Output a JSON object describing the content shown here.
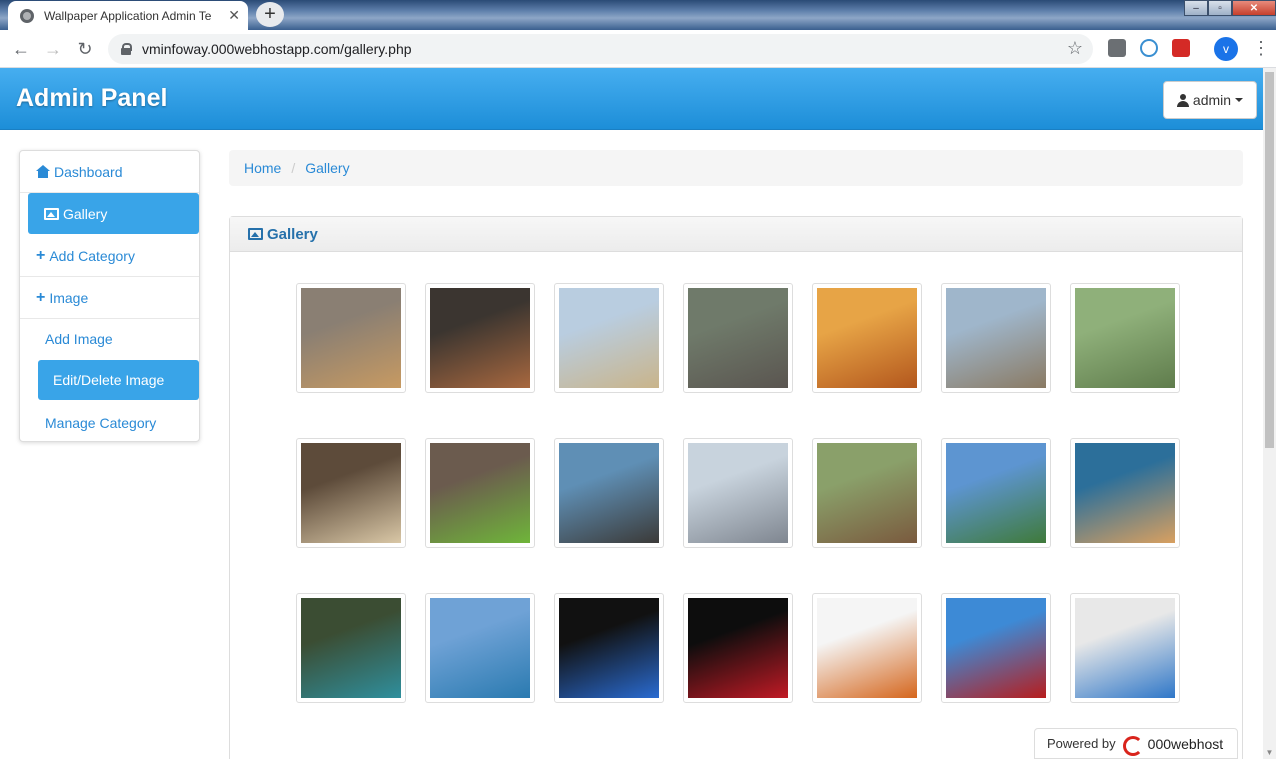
{
  "browser": {
    "tab_title": "Wallpaper Application Admin Te",
    "url": "vminfoway.000webhostapp.com/gallery.php",
    "profile_initial": "v"
  },
  "navbar": {
    "brand": "Admin Panel",
    "user_label": "admin"
  },
  "sidebar": {
    "items": [
      {
        "label": "Dashboard",
        "icon": "home-icon"
      },
      {
        "label": "Gallery",
        "icon": "picture-icon"
      },
      {
        "label": "Add Category",
        "icon": "plus-icon"
      },
      {
        "label": "Image",
        "icon": "plus-icon"
      }
    ],
    "sub_items": [
      {
        "label": "Add Image"
      },
      {
        "label": "Edit/Delete Image"
      },
      {
        "label": "Manage Category"
      }
    ]
  },
  "breadcrumb": {
    "home": "Home",
    "current": "Gallery"
  },
  "panel": {
    "title": "Gallery"
  },
  "gallery": {
    "images": [
      {
        "subject": "cats",
        "colors": [
          "#8a7f73",
          "#c79a62"
        ]
      },
      {
        "subject": "deer",
        "colors": [
          "#3b3530",
          "#a8683f"
        ]
      },
      {
        "subject": "elephant",
        "colors": [
          "#b9cde0",
          "#c9b48a"
        ]
      },
      {
        "subject": "rhinoceros",
        "colors": [
          "#6f7a6a",
          "#5a5550"
        ]
      },
      {
        "subject": "lion",
        "colors": [
          "#e7a446",
          "#b3571d"
        ]
      },
      {
        "subject": "giraffes",
        "colors": [
          "#9fb6cb",
          "#8a7a63"
        ]
      },
      {
        "subject": "bulbul bird",
        "colors": [
          "#8fb07a",
          "#5f7c4c"
        ]
      },
      {
        "subject": "owl",
        "colors": [
          "#5d4b3a",
          "#d9c7a6"
        ]
      },
      {
        "subject": "parrot",
        "colors": [
          "#6b5b4e",
          "#6fb53a"
        ]
      },
      {
        "subject": "penguin",
        "colors": [
          "#5f8fb5",
          "#3b3a38"
        ]
      },
      {
        "subject": "pigeon",
        "colors": [
          "#c8d3dd",
          "#7f8690"
        ]
      },
      {
        "subject": "sparrow",
        "colors": [
          "#8aa06a",
          "#7a5a3e"
        ]
      },
      {
        "subject": "river",
        "colors": [
          "#5d95d1",
          "#3f7a3a"
        ]
      },
      {
        "subject": "lake",
        "colors": [
          "#2c6f9a",
          "#d9a060"
        ]
      },
      {
        "subject": "waterfall",
        "colors": [
          "#3b4d33",
          "#2f8f9d"
        ]
      },
      {
        "subject": "mountain lake",
        "colors": [
          "#6fa2d6",
          "#2a7ab0"
        ]
      },
      {
        "subject": "blue car",
        "colors": [
          "#111111",
          "#2a6bd1"
        ]
      },
      {
        "subject": "red car",
        "colors": [
          "#0d0d0d",
          "#c11a25"
        ]
      },
      {
        "subject": "orange suv",
        "colors": [
          "#f5f5f5",
          "#d5661d"
        ]
      },
      {
        "subject": "red convertible",
        "colors": [
          "#3d8ad6",
          "#b71d1d"
        ]
      },
      {
        "subject": "blue sports car",
        "colors": [
          "#e8e8e8",
          "#2f77c8"
        ]
      }
    ]
  },
  "footer": {
    "powered_by": "Powered by",
    "host_brand": "000webhost"
  }
}
